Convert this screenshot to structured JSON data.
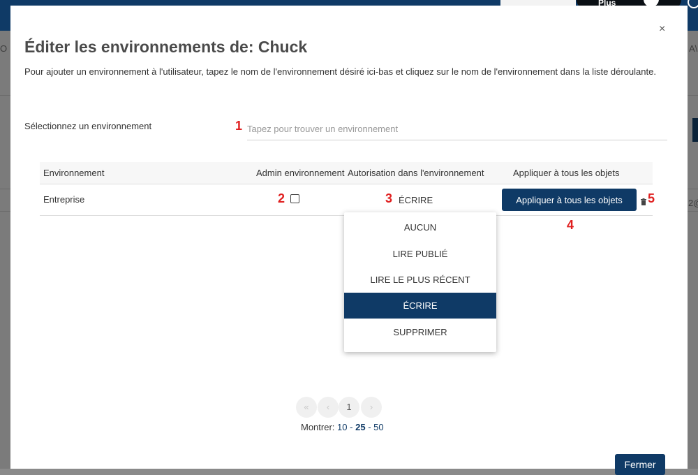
{
  "background": {
    "plus_label": "Plus",
    "left_fragment": "O",
    "right_fragment": "A\\",
    "row_fragment": "2@"
  },
  "modal": {
    "close_symbol": "×",
    "title": "Éditer les environnements de: Chuck",
    "description": "Pour ajouter un environnement à l'utilisateur, tapez le nom de l'environnement désiré ici-bas et cliquez sur le nom de l'environnement dans la liste déroulante.",
    "select_label": "Sélectionnez un environnement",
    "search_placeholder": "Tapez pour trouver un environnement",
    "close_button": "Fermer"
  },
  "markers": [
    "1",
    "2",
    "3",
    "4",
    "5"
  ],
  "table": {
    "headers": [
      "Environnement",
      "Admin environnement",
      "Autorisation dans l'environnement",
      "Appliquer à tous les objets"
    ],
    "rows": [
      {
        "environment": "Entreprise",
        "admin": false,
        "permission": "ÉCRIRE",
        "apply_button": "Appliquer à tous les objets"
      }
    ]
  },
  "permission_dropdown": {
    "options": [
      "AUCUN",
      "LIRE PUBLIÉ",
      "LIRE LE PLUS RÉCENT",
      "ÉCRIRE",
      "SUPPRIMER"
    ],
    "selected": "ÉCRIRE"
  },
  "pagination": {
    "first": "«",
    "prev": "‹",
    "current_page": "1",
    "next": "›",
    "show_label": "Montrer:",
    "page_sizes": [
      "10",
      "25",
      "50"
    ],
    "page_size_separator": "-",
    "selected_page_size": "25"
  },
  "colors": {
    "primary": "#0f3a66",
    "marker": "#e02020",
    "overlay": "#7b7b7b"
  }
}
